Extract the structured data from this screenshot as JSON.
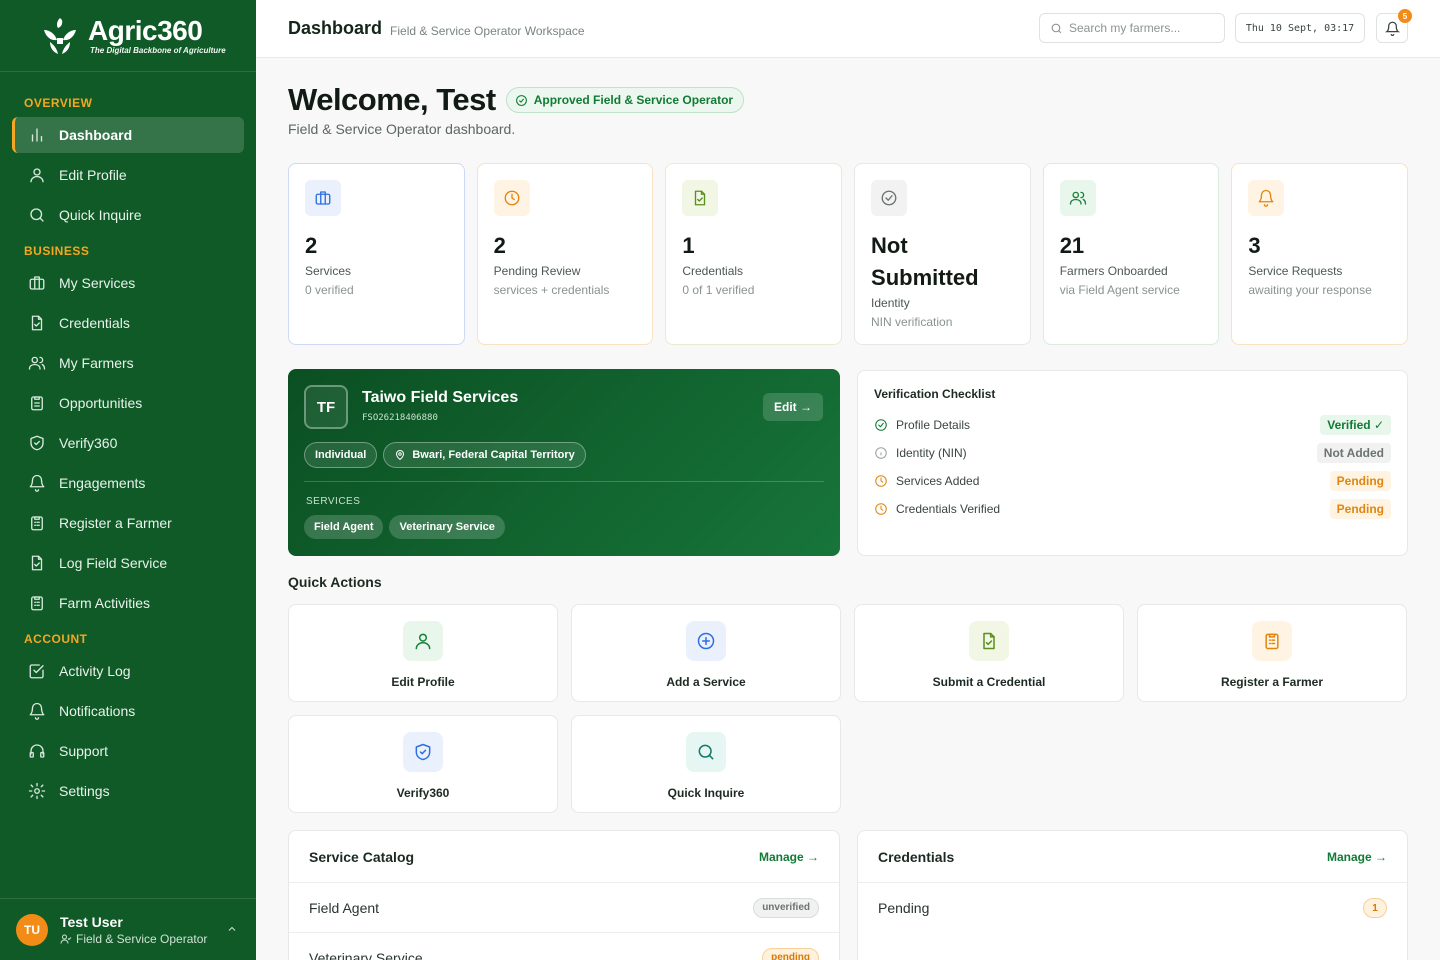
{
  "brand": {
    "name": "Agric360",
    "tagline": "The Digital Backbone of Agriculture"
  },
  "sidebar": {
    "sections": [
      {
        "title": "OVERVIEW",
        "items": [
          {
            "label": "Dashboard",
            "icon": "bar-chart-icon",
            "active": true
          },
          {
            "label": "Edit Profile",
            "icon": "user-icon"
          },
          {
            "label": "Quick Inquire",
            "icon": "search-icon"
          }
        ]
      },
      {
        "title": "BUSINESS",
        "items": [
          {
            "label": "My Services",
            "icon": "briefcase-icon"
          },
          {
            "label": "Credentials",
            "icon": "file-check-icon"
          },
          {
            "label": "My Farmers",
            "icon": "users-icon"
          },
          {
            "label": "Opportunities",
            "icon": "clipboard-icon"
          },
          {
            "label": "Verify360",
            "icon": "shield-check-icon"
          },
          {
            "label": "Engagements",
            "icon": "bell-icon"
          },
          {
            "label": "Register a Farmer",
            "icon": "clipboard-list-icon"
          },
          {
            "label": "Log Field Service",
            "icon": "file-check-icon"
          },
          {
            "label": "Farm Activities",
            "icon": "clipboard-list-icon"
          }
        ]
      },
      {
        "title": "ACCOUNT",
        "items": [
          {
            "label": "Activity Log",
            "icon": "check-square-icon"
          },
          {
            "label": "Notifications",
            "icon": "bell-icon"
          },
          {
            "label": "Support",
            "icon": "headphones-icon"
          },
          {
            "label": "Settings",
            "icon": "gear-icon"
          }
        ]
      }
    ],
    "user": {
      "initials": "TU",
      "name": "Test User",
      "role": "Field & Service Operator"
    }
  },
  "header": {
    "title": "Dashboard",
    "subtitle": "Field & Service Operator Workspace",
    "search_placeholder": "Search my farmers...",
    "datetime": "Thu 10 Sept, 03:17",
    "notifications_count": "5"
  },
  "welcome": {
    "title": "Welcome, Test",
    "badge": "Approved Field & Service Operator",
    "subtitle": "Field & Service Operator dashboard."
  },
  "stats": [
    {
      "value": "2",
      "label": "Services",
      "sub": "0 verified",
      "icon": "briefcase-icon",
      "color": "#2f6fe0",
      "bg": "#eaf1fd"
    },
    {
      "value": "2",
      "label": "Pending Review",
      "sub": "services + credentials",
      "icon": "clock-icon",
      "color": "#e0860f",
      "bg": "#fff4e3"
    },
    {
      "value": "1",
      "label": "Credentials",
      "sub": "0 of 1 verified",
      "icon": "file-check-icon",
      "color": "#5a8f1d",
      "bg": "#f1f7e4"
    },
    {
      "value": "Not Submitted",
      "label": "Identity",
      "sub": "NIN verification",
      "icon": "badge-check-icon",
      "color": "#6b746f",
      "bg": "#f1f2f1"
    },
    {
      "value": "21",
      "label": "Farmers Onboarded",
      "sub": "via Field Agent service",
      "icon": "users-icon",
      "color": "#16803a",
      "bg": "#e8f6ec"
    },
    {
      "value": "3",
      "label": "Service Requests",
      "sub": "awaiting your response",
      "icon": "bell-icon",
      "color": "#e0860f",
      "bg": "#fff4e3"
    }
  ],
  "profile": {
    "initials": "TF",
    "name": "Taiwo Field Services",
    "id": "FSO26218406880",
    "edit_label": "Edit →",
    "type": "Individual",
    "location": "Bwari, Federal Capital Territory",
    "services_label": "SERVICES",
    "services": [
      "Field Agent",
      "Veterinary Service"
    ]
  },
  "checklist": {
    "title": "Verification Checklist",
    "items": [
      {
        "label": "Profile Details",
        "status": "Verified ✓"
      },
      {
        "label": "Identity (NIN)",
        "status": "Not Added"
      },
      {
        "label": "Services Added",
        "status": "Pending"
      },
      {
        "label": "Credentials Verified",
        "status": "Pending"
      }
    ]
  },
  "quick_actions": {
    "title": "Quick Actions",
    "items": [
      {
        "label": "Edit Profile",
        "icon": "user-icon",
        "color": "#16803a",
        "bg": "#e8f6ec"
      },
      {
        "label": "Add a Service",
        "icon": "plus-circle-icon",
        "color": "#2f6fe0",
        "bg": "#eaf1fd"
      },
      {
        "label": "Submit a Credential",
        "icon": "file-check-icon",
        "color": "#5a8f1d",
        "bg": "#f1f7e4"
      },
      {
        "label": "Register a Farmer",
        "icon": "clipboard-list-icon",
        "color": "#e0860f",
        "bg": "#fff4e3"
      },
      {
        "label": "Verify360",
        "icon": "shield-check-icon",
        "color": "#2f6fe0",
        "bg": "#eaf1fd"
      },
      {
        "label": "Quick Inquire",
        "icon": "search-icon",
        "color": "#127a6a",
        "bg": "#e6f6f2"
      }
    ]
  },
  "service_catalog": {
    "title": "Service Catalog",
    "manage_label": "Manage →",
    "rows": [
      {
        "name": "Field Agent",
        "status": "unverified"
      },
      {
        "name": "Veterinary Service",
        "status": "pending"
      }
    ]
  },
  "credentials": {
    "title": "Credentials",
    "manage_label": "Manage →",
    "rows": [
      {
        "name": "Pending",
        "count": "1"
      }
    ]
  }
}
